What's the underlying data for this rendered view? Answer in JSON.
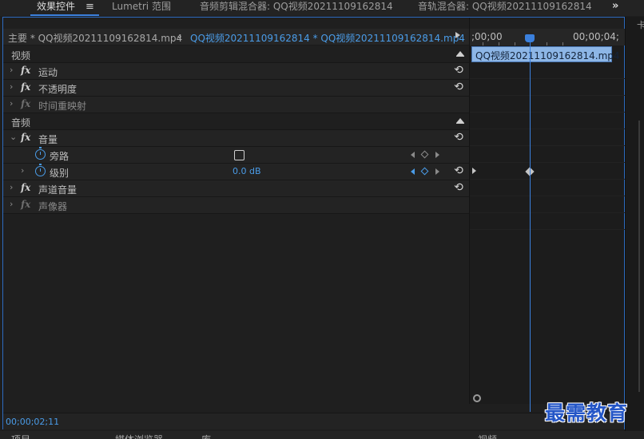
{
  "tabs": [
    {
      "label": "效果控件",
      "active": true
    },
    {
      "label": "Lumetri 范围",
      "active": false
    },
    {
      "label": "音频剪辑混合器: QQ视频20211109162814",
      "active": false
    },
    {
      "label": "音轨混合器: QQ视频20211109162814",
      "active": false
    }
  ],
  "tab_menu_icon": "≡",
  "overflow_icon": "»",
  "source": {
    "main": "主要 * QQ视频20211109162814.mp4",
    "chevron": "⌄",
    "clip": "QQ视频20211109162814 * QQ视频20211109162814.mp4"
  },
  "sections": {
    "video": "视频",
    "audio": "音频"
  },
  "effects": {
    "fx_symbol": "fx",
    "chevron_right": "›",
    "chevron_down": "⌄",
    "motion": "运动",
    "opacity": "不透明度",
    "time_remap": "时间重映射",
    "volume": "音量",
    "bypass": "旁路",
    "level": "级别",
    "level_value": "0.0 dB",
    "channel_volume": "声道音量",
    "panner": "声像器"
  },
  "reset_icon": "⟲",
  "timeline": {
    "tc_start": ";00;00",
    "tc_end": "00;00;04;",
    "clip_name": "QQ视频20211109162814.mp4"
  },
  "footer": {
    "timecode": "00;00;02;11"
  },
  "bottom": {
    "items": [
      "项目",
      "媒体浏览器",
      "库",
      "",
      "",
      "视频"
    ]
  },
  "right_edge_mark": "卡",
  "watermark": "最需教育",
  "colors": {
    "accent": "#3b80dd",
    "value_blue": "#4a9ce8",
    "clip_fill": "#8db6e6",
    "panel_bg": "#1f1f1f"
  }
}
